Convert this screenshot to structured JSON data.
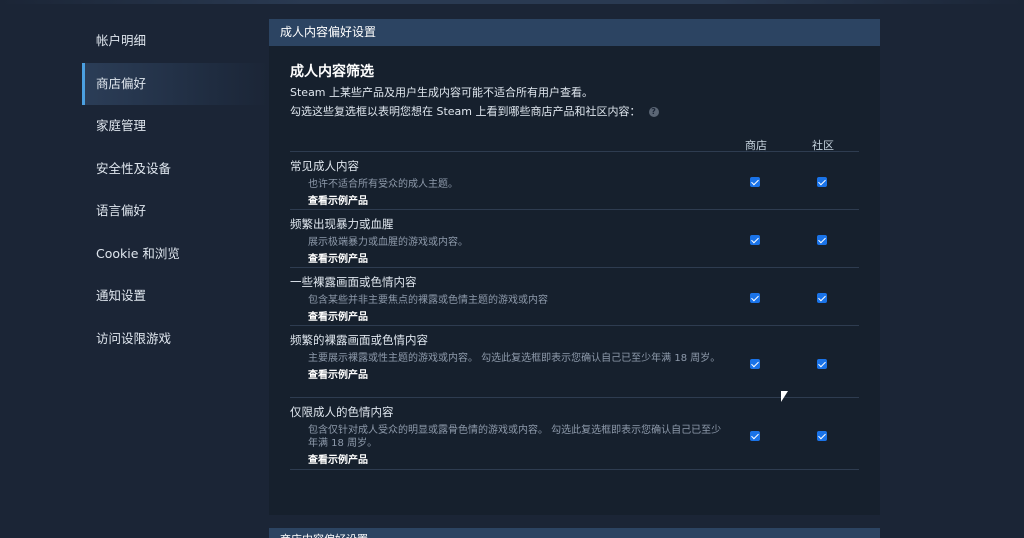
{
  "sidebar": {
    "items": [
      {
        "label": "帐户明细",
        "active": false
      },
      {
        "label": "商店偏好",
        "active": true
      },
      {
        "label": "家庭管理",
        "active": false
      },
      {
        "label": "安全性及设备",
        "active": false
      },
      {
        "label": "语言偏好",
        "active": false
      },
      {
        "label": "Cookie 和浏览",
        "active": false
      },
      {
        "label": "通知设置",
        "active": false
      },
      {
        "label": "访问设限游戏",
        "active": false
      }
    ]
  },
  "panel": {
    "header": "成人内容偏好设置",
    "section_title": "成人内容筛选",
    "desc1": "Steam 上某些产品及用户生成内容可能不适合所有用户查看。",
    "desc2": "勾选这些复选框以表明您想在 Steam 上看到哪些商店产品和社区内容：",
    "help_icon": "?",
    "col_store": "商店",
    "col_community": "社区",
    "rows": [
      {
        "title": "常见成人内容",
        "desc": "也许不适合所有受众的成人主题。",
        "link": "查看示例产品",
        "store_checked": true,
        "community_checked": true
      },
      {
        "title": "频繁出现暴力或血腥",
        "desc": "展示极端暴力或血腥的游戏或内容。",
        "link": "查看示例产品",
        "store_checked": true,
        "community_checked": true
      },
      {
        "title": "一些裸露画面或色情内容",
        "desc": "包含某些并非主要焦点的裸露或色情主题的游戏或内容",
        "link": "查看示例产品",
        "store_checked": true,
        "community_checked": true
      },
      {
        "title": "频繁的裸露画面或色情内容",
        "desc": "主要展示裸露或性主题的游戏或内容。 勾选此复选框即表示您确认自己已至少年满 18 周岁。",
        "link": "查看示例产品",
        "store_checked": true,
        "community_checked": true
      },
      {
        "title": "仅限成人的色情内容",
        "desc": "包含仅针对成人受众的明显或露骨色情的游戏或内容。 勾选此复选框即表示您确认自己已至少年满 18 周岁。",
        "link": "查看示例产品",
        "store_checked": true,
        "community_checked": true
      }
    ]
  },
  "panel2": {
    "header": "商店内容偏好设置"
  },
  "colors": {
    "background": "#1b2536",
    "panel": "#16202d",
    "header": "#2c4462",
    "checkbox": "#1a73e8",
    "accent": "#4b9fe0"
  }
}
